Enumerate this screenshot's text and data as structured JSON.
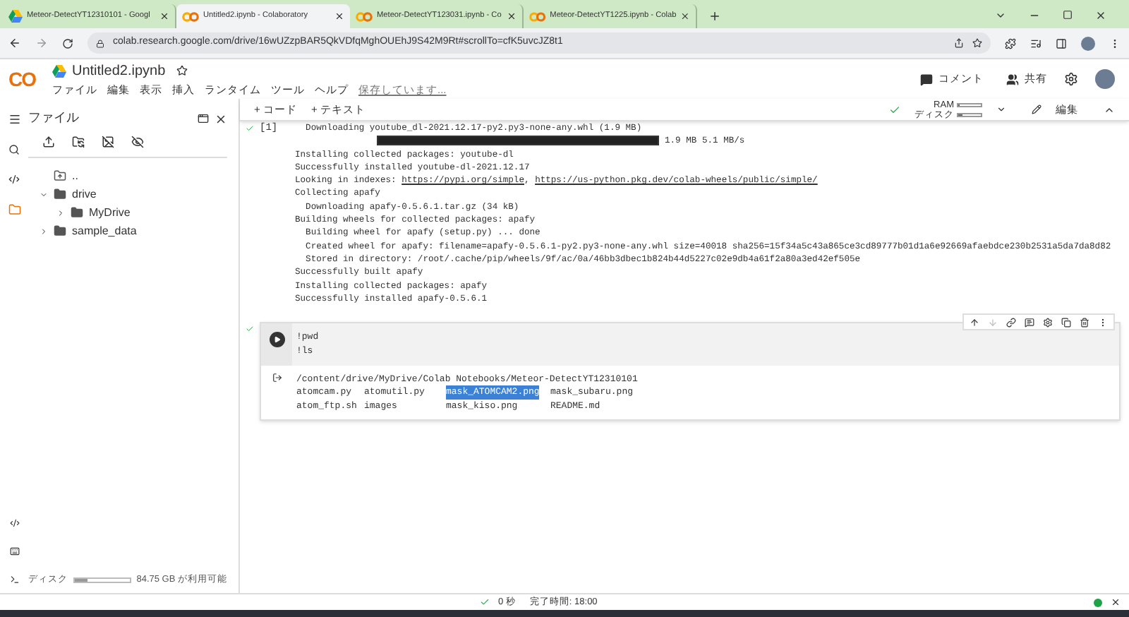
{
  "browser": {
    "tabs": [
      {
        "title": "Meteor-DetectYT12310101 - Googl",
        "kind": "drive",
        "selected": false
      },
      {
        "title": "Untitled2.ipynb - Colaboratory",
        "kind": "colab",
        "selected": true
      },
      {
        "title": "Meteor-DetectYT123031.ipynb - Co",
        "kind": "colab",
        "selected": false
      },
      {
        "title": "Meteor-DetectYT1225.ipynb - Colab",
        "kind": "colab",
        "selected": false
      }
    ],
    "url": "colab.research.google.com/drive/16wUZzpBAR5QkVDfqMghOUEhJ9S42M9Rt#scrollTo=cfK5uvcJZ8t1"
  },
  "header": {
    "logo": "CO",
    "title": "Untitled2.ipynb",
    "menu": [
      "ファイル",
      "編集",
      "表示",
      "挿入",
      "ランタイム",
      "ツール",
      "ヘルプ"
    ],
    "saving": "保存しています...",
    "comment": "コメント",
    "share": "共有"
  },
  "toolbar": {
    "add_code": "+ コード",
    "add_text": "+ テキスト",
    "ram": {
      "label": "RAM",
      "level": 0.05
    },
    "disk": {
      "label": "ディスク",
      "level": 0.2
    },
    "edit": "編集"
  },
  "sidebar": {
    "title": "ファイル",
    "tree": [
      {
        "name": "..",
        "kind": "up"
      },
      {
        "name": "drive",
        "kind": "folder",
        "expanded": true,
        "children": [
          {
            "name": "MyDrive",
            "kind": "folder",
            "expanded": false
          }
        ]
      },
      {
        "name": "sample_data",
        "kind": "folder",
        "expanded": false
      }
    ],
    "disk": {
      "label": "ディスク",
      "level": 0.22,
      "free": "84.75 GB が利用可能"
    }
  },
  "cells": [
    {
      "count": "[1]",
      "output": [
        {
          "kind": "text",
          "text": "  Downloading youtube_dl-2021.12.17-py2.py3-none-any.whl (1.9 MB)"
        },
        {
          "kind": "progress",
          "level": 1,
          "text": "1.9 MB 5.1 MB/s"
        },
        {
          "kind": "text",
          "text": "Installing collected packages: youtube-dl"
        },
        {
          "kind": "text",
          "text": "Successfully installed youtube-dl-2021.12.17"
        },
        {
          "kind": "links",
          "text": "Looking in indexes: ",
          "separator": ",",
          "links": [
            "https://pypi.org/simple",
            "https://us-python.pkg.dev/colab-wheels/public/simple/"
          ]
        },
        {
          "kind": "text",
          "text": "Collecting apafy"
        },
        {
          "kind": "text",
          "text": "  Downloading apafy-0.5.6.1.tar.gz (34 kB)"
        },
        {
          "kind": "text",
          "text": "Building wheels for collected packages: apafy"
        },
        {
          "kind": "text",
          "text": "  Building wheel for apafy (setup.py) ... done"
        },
        {
          "kind": "text",
          "text": "  Created wheel for apafy: filename=apafy-0.5.6.1-py2.py3-none-any.whl size=40018 sha256=15f34a5c43a865ce3cd89777b01d1a6e92669afaebdce230b2531a5da7da8d82"
        },
        {
          "kind": "text",
          "text": "  Stored in directory: /root/.cache/pip/wheels/9f/ac/0a/46bb3dbec1b824b44d5227c02e9db4a61f2a80a3ed42ef505e"
        },
        {
          "kind": "text",
          "text": "Successfully built apafy"
        },
        {
          "kind": "text",
          "text": "Installing collected packages: apafy"
        },
        {
          "kind": "text",
          "text": "Successfully installed apafy-0.5.6.1"
        }
      ]
    },
    {
      "code": [
        "!pwd",
        "!ls"
      ],
      "output": [
        {
          "kind": "text",
          "text": "/content/drive/MyDrive/Colab Notebooks/Meteor-DetectYT12310101"
        }
      ],
      "files": [
        {
          "name": "atomcam.py",
          "selected": false
        },
        {
          "name": "atomutil.py",
          "selected": false
        },
        {
          "name": "mask_ATOMCAM2.png",
          "selected": true
        },
        {
          "name": "mask_subaru.png",
          "selected": false
        },
        {
          "name": "atom_ftp.sh",
          "selected": false
        },
        {
          "name": "images",
          "selected": false
        },
        {
          "name": "mask_kiso.png",
          "selected": false
        },
        {
          "name": "README.md",
          "selected": false
        }
      ]
    }
  ],
  "status": {
    "duration": "0 秒",
    "finished": "完了時間: 18:00"
  }
}
